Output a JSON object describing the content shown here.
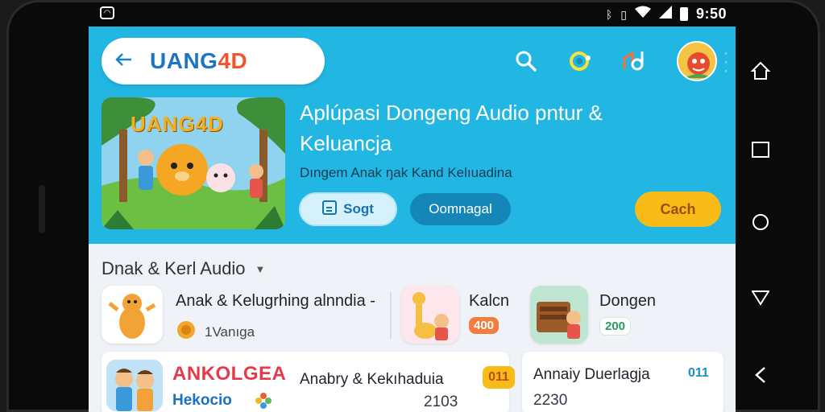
{
  "status_bar": {
    "time": "9:50",
    "icons": [
      "app-notification-icon",
      "bluetooth-icon",
      "vibrate-icon",
      "wifi-icon",
      "signal-icon",
      "battery-icon"
    ]
  },
  "header": {
    "brand_part1": "UANG",
    "brand_part2": "4D",
    "icons": [
      "search-icon",
      "theme-icon",
      "music-icon",
      "profile-avatar"
    ]
  },
  "feature": {
    "image_title": "UANG4D",
    "title": "Aplúpasi Dongeng Audio pntur & Keluancja",
    "subtitle": "Dıngem Anak ŋak Kand Kelıuadina",
    "button_primary": "Sogt",
    "button_secondary": "Oomnagal",
    "button_action": "Cach"
  },
  "section": {
    "title": "Dnak & Kerl Audio"
  },
  "row1": [
    {
      "title": "Anak & Kelugrhing alnndia -",
      "meta": "1Vanıga"
    },
    {
      "title": "Kalcn",
      "badge": "400"
    },
    {
      "title": "Dongen",
      "badge": "200"
    }
  ],
  "row2": [
    {
      "thumb_title": "ANKOLGEA",
      "thumb_subtitle": "Hekocio",
      "title": "Anabry & Kekıhaduia",
      "badge": "011",
      "count": "2103"
    },
    {
      "title": "Annaiy Duerlagja",
      "badge": "011",
      "count": "2230"
    }
  ],
  "colors": {
    "hero_bg": "#22b6e2",
    "brand_blue": "#1d74c6",
    "brand_orange": "#f0572c",
    "accent_yellow": "#f8bb17"
  }
}
